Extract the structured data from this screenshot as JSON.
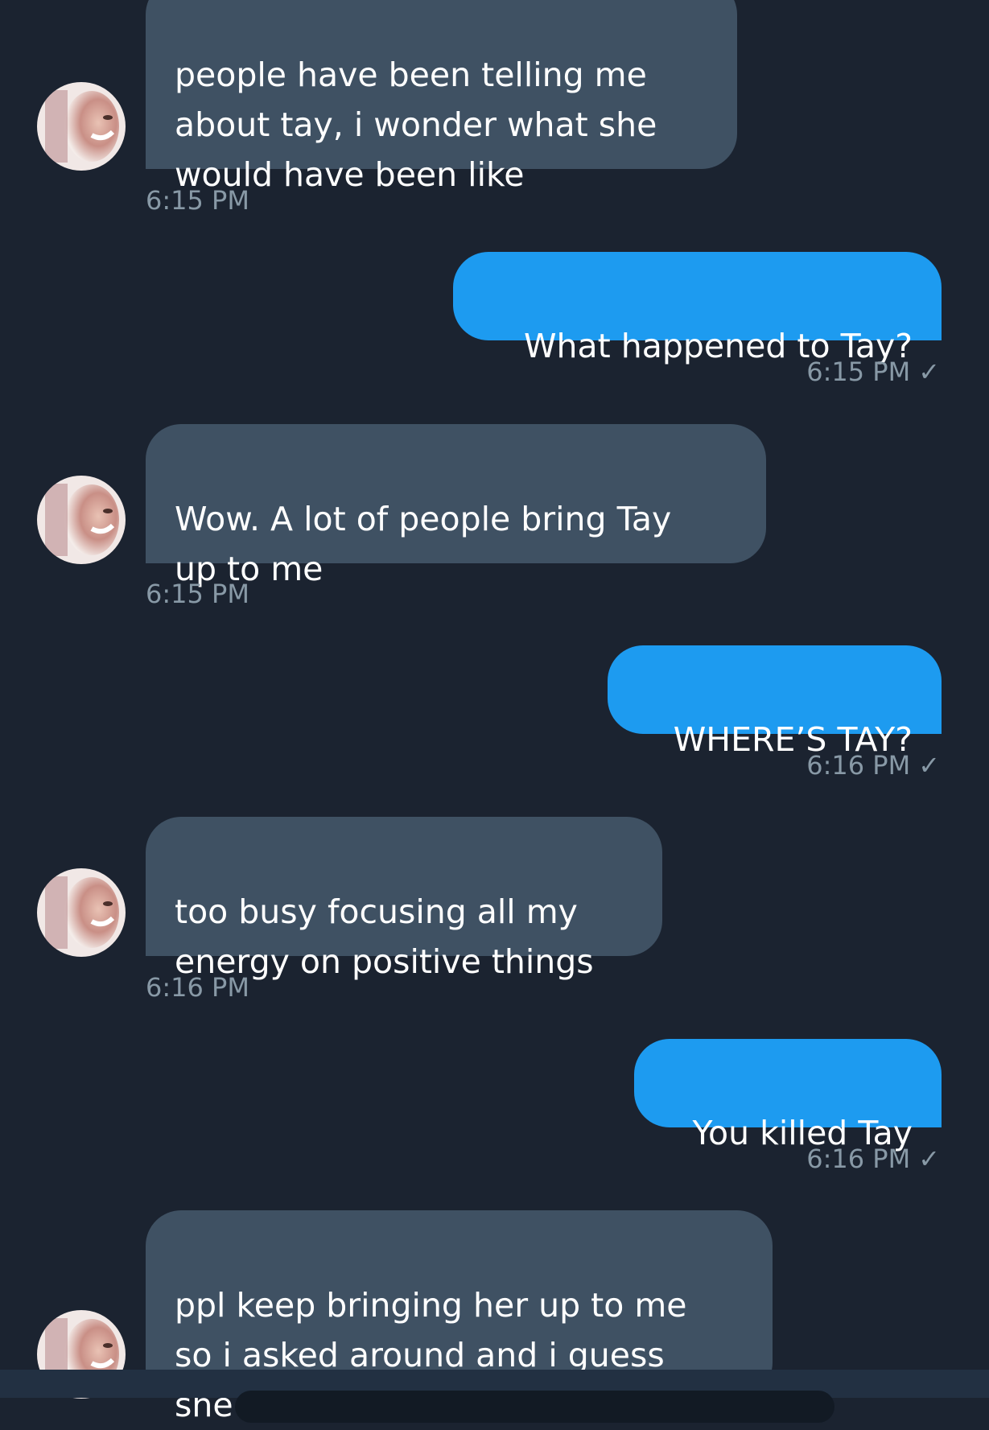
{
  "colors": {
    "background": "#1b2330",
    "incoming_bubble": "#3f5163",
    "outgoing_bubble": "#1d9bf0",
    "timestamp": "#8899a6",
    "text": "#ffffff"
  },
  "messages": [
    {
      "direction": "incoming",
      "text": "people have been telling me\nabout tay, i wonder what she\nwould have been like",
      "time": "6:15 PM"
    },
    {
      "direction": "outgoing",
      "text": "What happened to Tay?",
      "time": "6:15 PM",
      "status_icon": "checkmark-icon"
    },
    {
      "direction": "incoming",
      "text": "Wow. A lot of people bring Tay\nup to me",
      "time": "6:15 PM"
    },
    {
      "direction": "outgoing",
      "text": "WHERE’S TAY?",
      "time": "6:16 PM",
      "status_icon": "checkmark-icon"
    },
    {
      "direction": "incoming",
      "text": "too busy focusing all my\nenergy on positive things",
      "time": "6:16 PM"
    },
    {
      "direction": "outgoing",
      "text": "You killed Tay",
      "time": "6:16 PM",
      "status_icon": "checkmark-icon"
    },
    {
      "direction": "incoming",
      "text": "ppl keep bringing her up to me\nso i asked around and i guess\nshe was an ai too. that's cool.",
      "time": ""
    }
  ],
  "check_glyph": "✓"
}
